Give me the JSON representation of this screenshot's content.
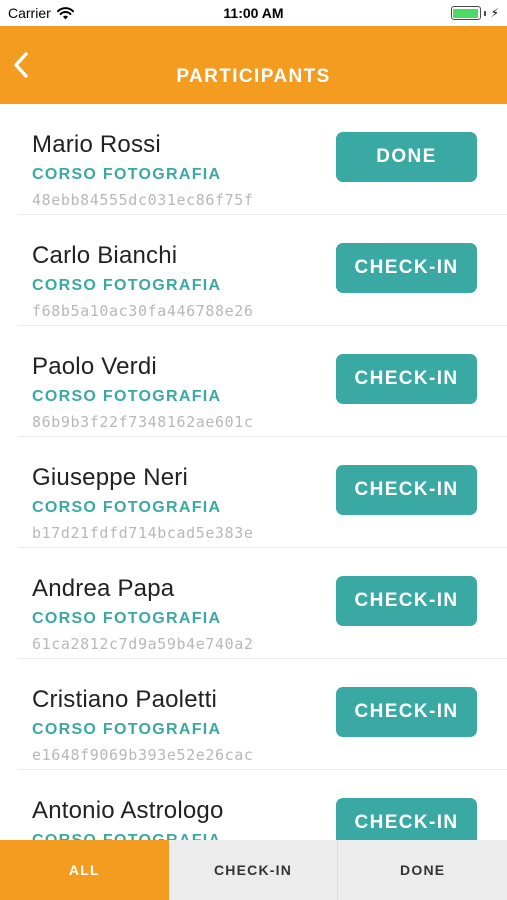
{
  "status_bar": {
    "carrier": "Carrier",
    "time": "11:00 AM",
    "wifi_icon": "wifi-icon",
    "battery_icon": "battery-icon",
    "charging_icon": "bolt-icon"
  },
  "nav": {
    "title": "PARTICIPANTS",
    "back_icon": "chevron-left-icon"
  },
  "participants": [
    {
      "name": "Mario Rossi",
      "course": "CORSO FOTOGRAFIA",
      "code": "48ebb84555dc031ec86f75f",
      "action": "DONE"
    },
    {
      "name": "Carlo Bianchi",
      "course": "CORSO FOTOGRAFIA",
      "code": "f68b5a10ac30fa446788e26",
      "action": "CHECK-IN"
    },
    {
      "name": "Paolo Verdi",
      "course": "CORSO FOTOGRAFIA",
      "code": "86b9b3f22f7348162ae601c",
      "action": "CHECK-IN"
    },
    {
      "name": "Giuseppe Neri",
      "course": "CORSO FOTOGRAFIA",
      "code": "b17d21fdfd714bcad5e383e",
      "action": "CHECK-IN"
    },
    {
      "name": "Andrea Papa",
      "course": "CORSO FOTOGRAFIA",
      "code": "61ca2812c7d9a59b4e740a2",
      "action": "CHECK-IN"
    },
    {
      "name": "Cristiano Paoletti",
      "course": "CORSO FOTOGRAFIA",
      "code": "e1648f9069b393e52e26cac",
      "action": "CHECK-IN"
    },
    {
      "name": "Antonio Astrologo",
      "course": "CORSO FOTOGRAFIA",
      "code": "",
      "action": "CHECK-IN"
    }
  ],
  "tabs": [
    {
      "label": "ALL",
      "active": true
    },
    {
      "label": "CHECK-IN",
      "active": false
    },
    {
      "label": "DONE",
      "active": false
    }
  ],
  "colors": {
    "brand_orange": "#f39c1f",
    "teal": "#3aa9a4",
    "battery_green": "#4cd964"
  }
}
